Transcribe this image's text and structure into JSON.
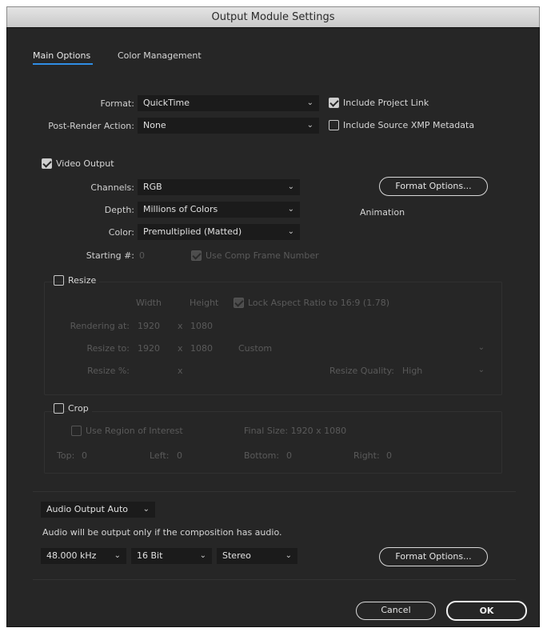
{
  "window": {
    "title": "Output Module Settings"
  },
  "tabs": [
    {
      "label": "Main Options",
      "active": true
    },
    {
      "label": "Color Management",
      "active": false
    }
  ],
  "format": {
    "label": "Format:",
    "value": "QuickTime"
  },
  "post_render": {
    "label": "Post-Render Action:",
    "value": "None"
  },
  "include_project_link": {
    "label": "Include Project Link",
    "checked": true
  },
  "include_xmp": {
    "label": "Include Source XMP Metadata",
    "checked": false
  },
  "video_output": {
    "label": "Video Output",
    "checked": true,
    "channels": {
      "label": "Channels:",
      "value": "RGB"
    },
    "depth": {
      "label": "Depth:",
      "value": "Millions of Colors"
    },
    "color": {
      "label": "Color:",
      "value": "Premultiplied (Matted)"
    },
    "starting": {
      "label": "Starting #:",
      "value": "0"
    },
    "use_comp_frame": {
      "label": "Use Comp Frame Number",
      "checked": true
    },
    "format_options_label": "Format Options...",
    "codec": "Animation"
  },
  "resize": {
    "label": "Resize",
    "checked": false,
    "width_header": "Width",
    "height_header": "Height",
    "lock_aspect": {
      "label": "Lock Aspect Ratio to 16:9 (1.78)",
      "checked": true
    },
    "rendering_at": {
      "label": "Rendering at:",
      "width": "1920",
      "x": "x",
      "height": "1080"
    },
    "resize_to": {
      "label": "Resize to:",
      "width": "1920",
      "x": "x",
      "height": "1080",
      "preset": "Custom"
    },
    "resize_pct": {
      "label": "Resize %:",
      "x": "x"
    },
    "quality": {
      "label": "Resize Quality:",
      "value": "High"
    }
  },
  "crop": {
    "label": "Crop",
    "checked": false,
    "use_roi": {
      "label": "Use Region of Interest",
      "checked": false
    },
    "final_size": "Final Size: 1920 x 1080",
    "top": {
      "label": "Top:",
      "value": "0"
    },
    "left": {
      "label": "Left:",
      "value": "0"
    },
    "bottom": {
      "label": "Bottom:",
      "value": "0"
    },
    "right": {
      "label": "Right:",
      "value": "0"
    }
  },
  "audio": {
    "mode": "Audio Output Auto",
    "note": "Audio will be output only if the composition has audio.",
    "rate": "48.000 kHz",
    "bits": "16 Bit",
    "channels": "Stereo",
    "format_options_label": "Format Options..."
  },
  "buttons": {
    "cancel": "Cancel",
    "ok": "OK"
  },
  "chevron": "⌄"
}
